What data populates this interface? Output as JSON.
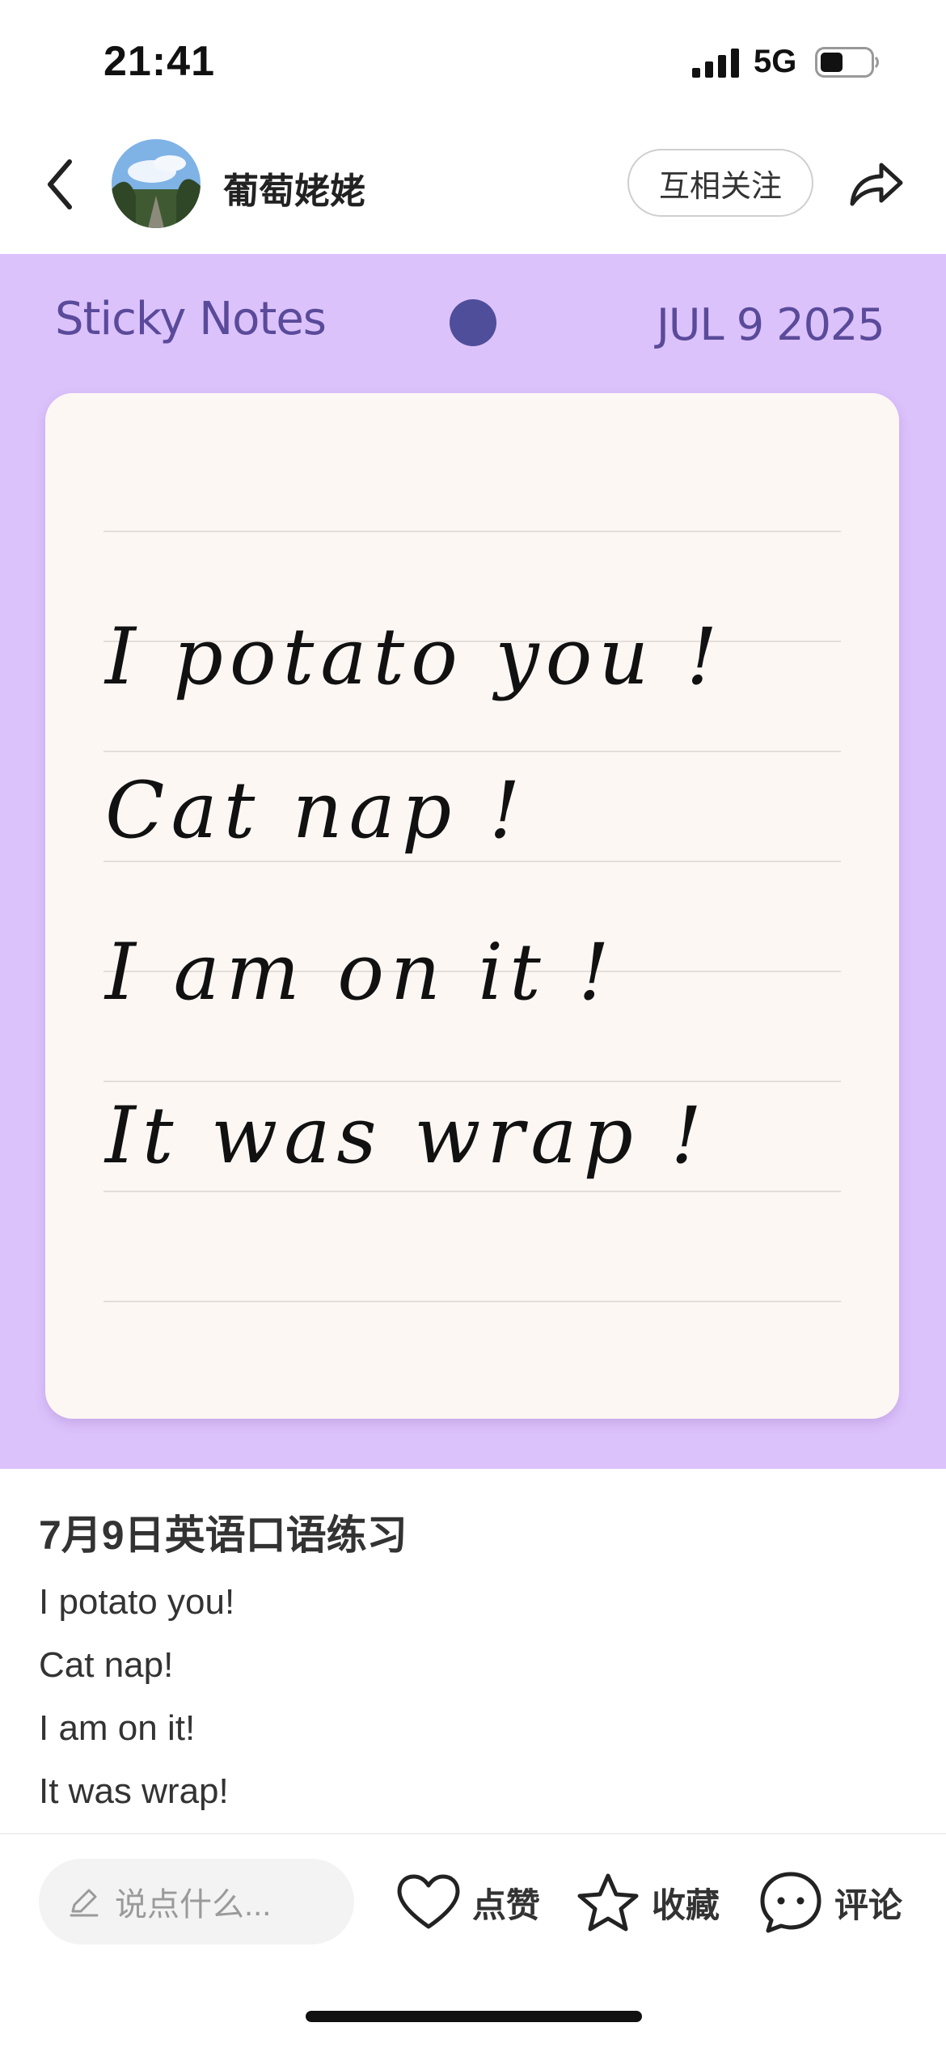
{
  "status_bar": {
    "time": "21:41",
    "network": "5G",
    "battery_level": 0.45
  },
  "nav": {
    "username": "葡萄姥姥",
    "follow_label": "互相关注"
  },
  "sticky": {
    "title": "Sticky Notes",
    "date": "JUL 9 2025",
    "lines": [
      "I potato you !",
      "Cat nap !",
      "I am on it !",
      "It was wrap !"
    ]
  },
  "post": {
    "title": "7月9日英语口语练习",
    "lines": [
      "I potato you!",
      "Cat nap!",
      "I am on it!",
      "It was wrap!"
    ]
  },
  "bottom_bar": {
    "comment_placeholder": "说点什么...",
    "like_label": "点赞",
    "collect_label": "收藏",
    "comment_label": "评论"
  },
  "colors": {
    "hero_bg": "#dcc2fb",
    "accent_dot": "#4f4e9a",
    "title_purple": "#5a4a9a"
  }
}
